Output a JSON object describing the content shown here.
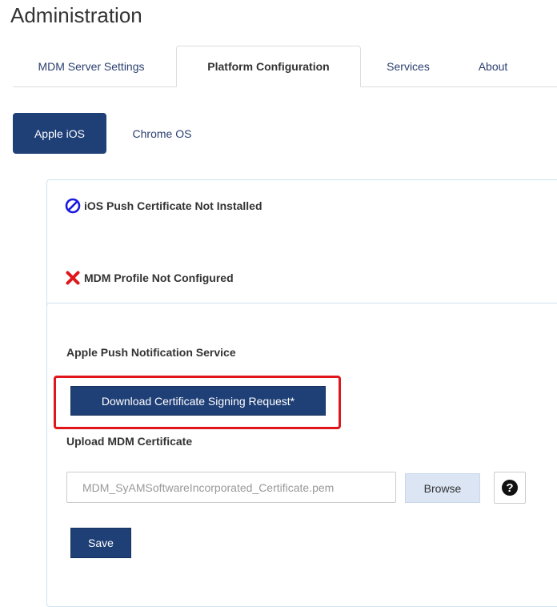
{
  "header": {
    "title": "Administration"
  },
  "tabs": [
    {
      "label": "MDM Server Settings"
    },
    {
      "label": "Platform Configuration"
    },
    {
      "label": "Services"
    },
    {
      "label": "About"
    }
  ],
  "pills": [
    {
      "label": "Apple iOS"
    },
    {
      "label": "Chrome OS"
    }
  ],
  "status": {
    "push_cert": "iOS Push Certificate Not Installed",
    "mdm_profile": "MDM Profile Not Configured"
  },
  "apns": {
    "title": "Apple Push Notification Service",
    "download_csr_label": "Download Certificate Signing Request*",
    "upload_label": "Upload MDM Certificate",
    "file_value": "MDM_SyAMSoftwareIncorporated_Certificate.pem",
    "browse_label": "Browse",
    "save_label": "Save"
  },
  "colors": {
    "primary": "#1f3f77",
    "error_red": "#e0161b",
    "info_blue": "#1a1adf",
    "panel_border": "#cfe3ec"
  }
}
